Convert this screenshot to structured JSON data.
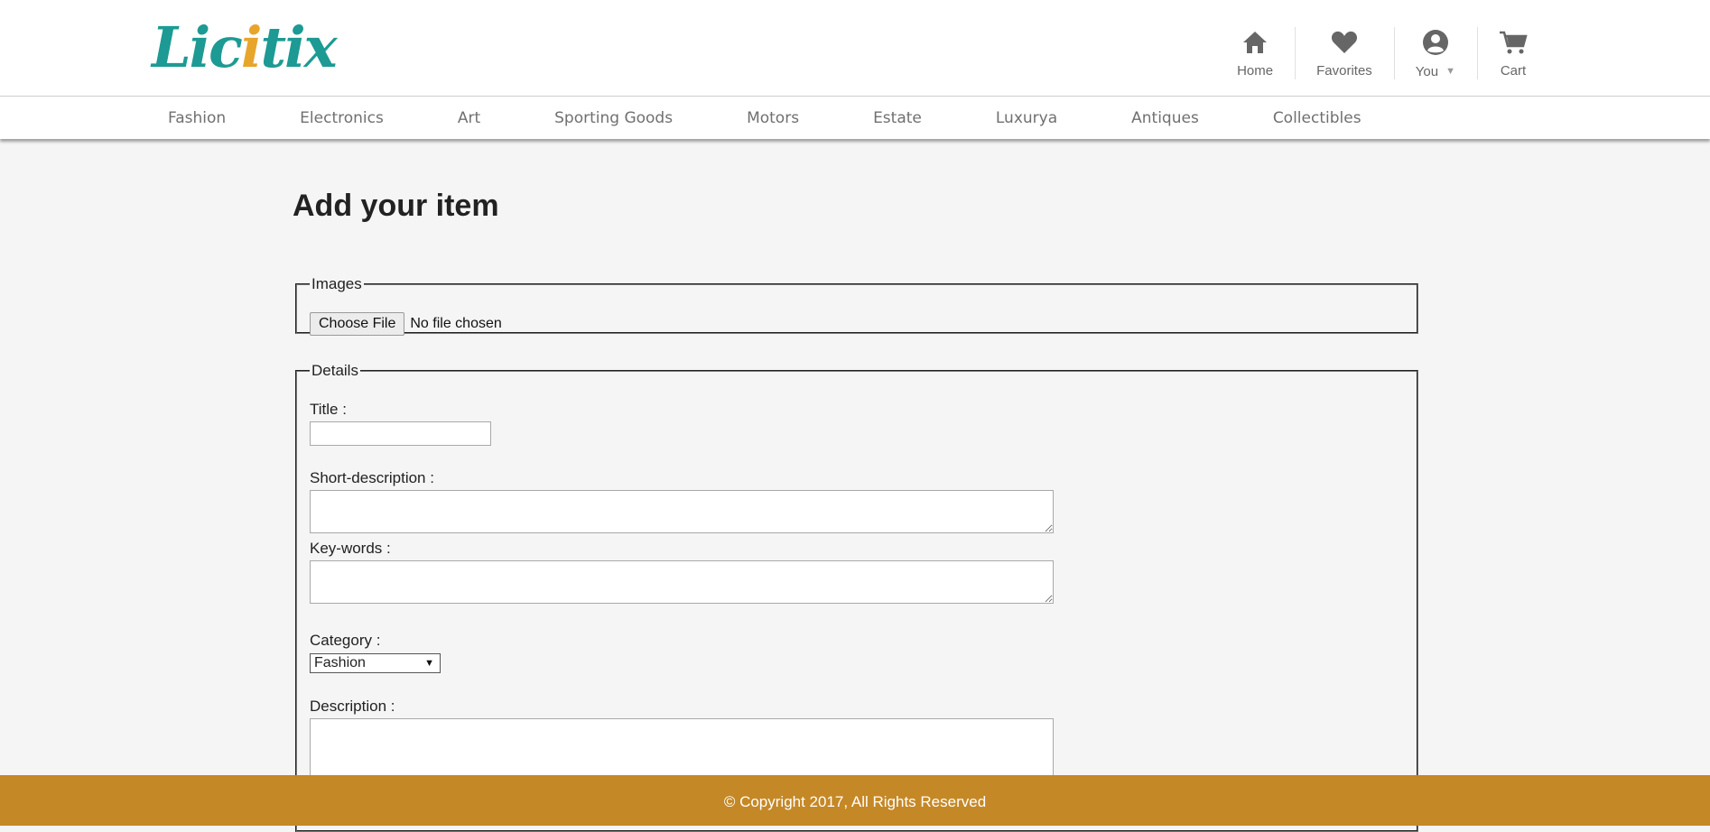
{
  "brand": {
    "logo_text_a": "Lic",
    "logo_text_accent": "i",
    "logo_text_b": "tix",
    "primary": "#1c9a93",
    "accent": "#e8a52c"
  },
  "top_nav": [
    {
      "label": "Home",
      "icon": "home-icon"
    },
    {
      "label": "Favorites",
      "icon": "heart-icon"
    },
    {
      "label": "You",
      "icon": "user-icon",
      "has_dropdown": true
    },
    {
      "label": "Cart",
      "icon": "cart-icon"
    }
  ],
  "categories": [
    "Fashion",
    "Electronics",
    "Art",
    "Sporting Goods",
    "Motors",
    "Estate",
    "Luxurya",
    "Antiques",
    "Collectibles"
  ],
  "page": {
    "title": "Add your item"
  },
  "images_section": {
    "legend": "Images",
    "choose_file_label": "Choose File",
    "file_status": "No file chosen"
  },
  "details_section": {
    "legend": "Details",
    "title_label": "Title :",
    "title_value": "",
    "short_description_label": "Short-description :",
    "short_description_value": "",
    "keywords_label": "Key-words :",
    "keywords_value": "",
    "category_label": "Category :",
    "category_selected": "Fashion",
    "description_label": "Description :",
    "description_value": ""
  },
  "footer": {
    "text": "© Copyright 2017, All Rights Reserved",
    "color": "#c58826"
  }
}
